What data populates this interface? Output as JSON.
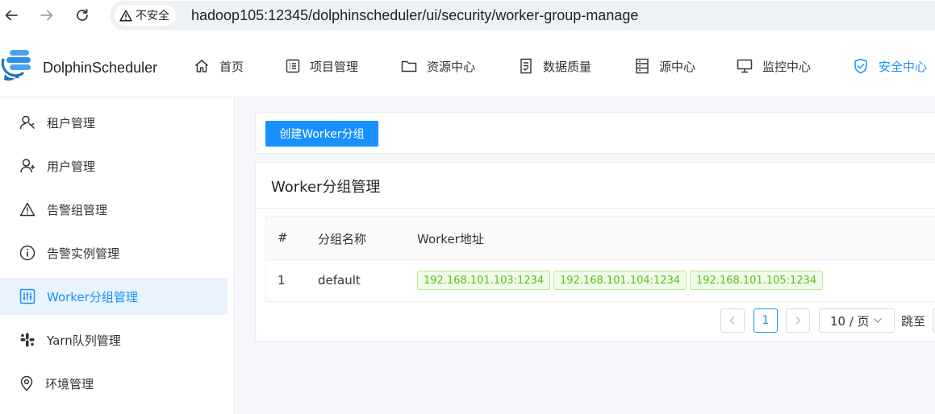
{
  "browser": {
    "security_label": "不安全",
    "url": "hadoop105:12345/dolphinscheduler/ui/security/worker-group-manage"
  },
  "header": {
    "brand": "DolphinScheduler",
    "menu": [
      {
        "label": "首页",
        "icon": "home-icon"
      },
      {
        "label": "项目管理",
        "icon": "project-icon"
      },
      {
        "label": "资源中心",
        "icon": "folder-icon"
      },
      {
        "label": "数据质量",
        "icon": "data-quality-icon"
      },
      {
        "label": "源中心",
        "icon": "datasource-icon"
      },
      {
        "label": "监控中心",
        "icon": "monitor-icon"
      },
      {
        "label": "安全中心",
        "icon": "shield-check-icon",
        "active": true
      }
    ]
  },
  "sidebar": {
    "items": [
      {
        "label": "租户管理",
        "icon": "tenant-icon"
      },
      {
        "label": "用户管理",
        "icon": "user-add-icon"
      },
      {
        "label": "告警组管理",
        "icon": "warning-icon"
      },
      {
        "label": "告警实例管理",
        "icon": "info-circle-icon"
      },
      {
        "label": "Worker分组管理",
        "icon": "sliders-icon",
        "active": true
      },
      {
        "label": "Yarn队列管理",
        "icon": "slack-icon"
      },
      {
        "label": "环境管理",
        "icon": "location-icon"
      }
    ]
  },
  "main": {
    "create_button": "创建Worker分组",
    "card_title": "Worker分组管理",
    "table": {
      "columns": [
        "#",
        "分组名称",
        "Worker地址"
      ],
      "rows": [
        {
          "index": "1",
          "name": "default",
          "addresses": [
            "192.168.101.103:1234",
            "192.168.101.104:1234",
            "192.168.101.105:1234"
          ]
        }
      ]
    },
    "pagination": {
      "prev": "<",
      "current_page": "1",
      "next": ">",
      "page_size": "10 / 页",
      "jump_label": "跳至"
    }
  },
  "colors": {
    "accent": "#1890ff",
    "tag_text": "#52c41a",
    "tag_bg": "#f0fbe9",
    "tag_border": "#b7eb8f"
  }
}
